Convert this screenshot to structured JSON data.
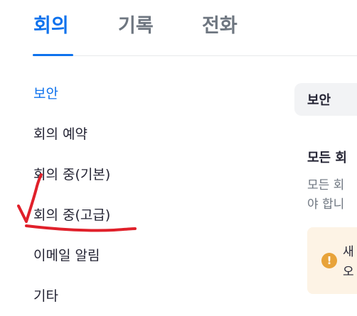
{
  "tabs": [
    {
      "label": "회의",
      "active": true
    },
    {
      "label": "기록",
      "active": false
    },
    {
      "label": "전화",
      "active": false
    }
  ],
  "sidebar": {
    "items": [
      {
        "label": "보안",
        "active": true
      },
      {
        "label": "회의 예약",
        "active": false
      },
      {
        "label": "회의 중(기본)",
        "active": false
      },
      {
        "label": "회의 중(고급)",
        "active": false
      },
      {
        "label": "이메일 알림",
        "active": false
      },
      {
        "label": "기타",
        "active": false
      }
    ]
  },
  "main": {
    "section_title": "보안",
    "setting_title": "모든 회",
    "setting_desc_line1": "모든 회",
    "setting_desc_line2": "야 합니",
    "notice_line1": "새",
    "notice_line2": "오",
    "notice_icon": "!"
  },
  "colors": {
    "accent": "#0e72ed",
    "annotation": "#e0202a",
    "warning": "#e8a33a"
  }
}
